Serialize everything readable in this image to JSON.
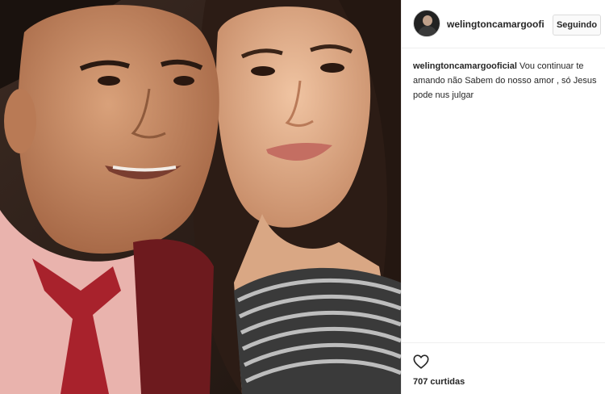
{
  "post": {
    "username": "welingtoncamargooficial",
    "header_username": "welingtoncamargoofic",
    "follow_label": "Seguindo",
    "caption_text": "Vou continuar te amando não Sabem do nosso amor , só Jesus pode nus julgar",
    "likes_label": "707 curtidas"
  },
  "icons": {
    "like": "heart-icon",
    "avatar": "profile-avatar"
  },
  "colors": {
    "text": "#262626",
    "border": "#efefef",
    "button_bg": "#fafafa"
  }
}
